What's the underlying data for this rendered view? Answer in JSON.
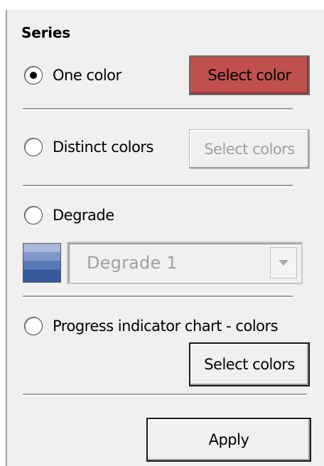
{
  "series": {
    "title": "Series",
    "options": [
      {
        "label": "One color",
        "checked": true,
        "button_label": "Select color",
        "button_state": "active",
        "button_color": "#c0504d"
      },
      {
        "label": "Distinct colors",
        "checked": false,
        "button_label": "Select colors",
        "button_state": "disabled"
      },
      {
        "label": "Degrade",
        "checked": false,
        "combo_value": "Degrade 1",
        "combo_state": "disabled"
      },
      {
        "label": "Progress indicator chart - colors",
        "checked": false,
        "button_label": "Select colors",
        "button_state": "enabled"
      }
    ],
    "apply_label": "Apply"
  },
  "icons": {
    "gradient_swatch": "gradient-swatch-icon",
    "dropdown": "chevron-down-icon"
  }
}
